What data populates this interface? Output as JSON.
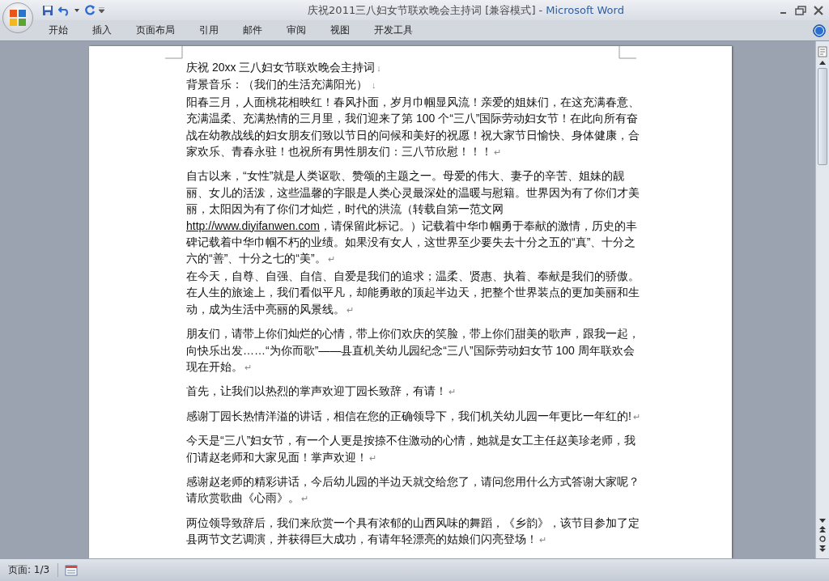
{
  "window": {
    "title": "庆祝2011三八妇女节联欢晚会主持词 [兼容模式]",
    "separator": "-",
    "app_name": "Microsoft Word"
  },
  "ribbon_tabs": [
    {
      "label": "开始",
      "selected": false
    },
    {
      "label": "插入",
      "selected": false
    },
    {
      "label": "页面布局",
      "selected": false
    },
    {
      "label": "引用",
      "selected": false
    },
    {
      "label": "邮件",
      "selected": false
    },
    {
      "label": "审阅",
      "selected": false
    },
    {
      "label": "视图",
      "selected": false
    },
    {
      "label": "开发工具",
      "selected": false
    }
  ],
  "document": {
    "blocks": [
      [
        {
          "text": "庆祝 20xx 三八妇女节联欢晚会主持词",
          "mark": "↓"
        },
        {
          "text": "背景音乐：（我们的生活充满阳光）",
          "mark": " ↓"
        },
        {
          "text": "阳春三月，人面桃花相映红！春风扑面，岁月巾帼显风流！亲爱的姐妹们，在这充满春意、充满温柔、充满热情的三月里，我们迎来了第 100 个“三八”国际劳动妇女节！在此向所有奋战在幼教战线的妇女朋友们致以节日的问候和美好的祝愿！祝大家节日愉快、身体健康，合家欢乐、青春永驻！也祝所有男性朋友们：三八节欣慰！！！",
          "mark": "↵"
        }
      ],
      [
        {
          "text": "自古以来，“女性”就是人类讴歌、赞颂的主题之一。母爱的伟大、妻子的辛苦、姐妹的靓丽、女儿的活泼，这些温馨的字眼是人类心灵最深处的温暖与慰籍。世界因为有了你们才美丽，太阳因为有了你们才灿烂，时代的洪流（转载自第一范文网 ",
          "link": "http://www.diyifanwen.com",
          "after": "，请保留此标记。）记载着中华巾帼勇于奉献的激情，历史的丰碑记载着中华巾帼不朽的业绩。如果没有女人，这世界至少要失去十分之五的“真”、十分之六的“善”、十分之七的“美”。",
          "mark": "↵"
        },
        {
          "text": "在今天，自尊、自强、自信、自爱是我们的追求；温柔、贤惠、执着、奉献是我们的骄傲。在人生的旅途上，我们看似平凡，却能勇敢的顶起半边天，把整个世界装点的更加美丽和生动，成为生活中亮丽的风景线。",
          "mark": "↵"
        }
      ],
      [
        {
          "text": "朋友们，请带上你们灿烂的心情，带上你们欢庆的笑脸，带上你们甜美的歌声，跟我一起，向快乐出发……“为你而歌”——县直机关幼儿园纪念“三八”国际劳动妇女节 100 周年联欢会现在开始。",
          "mark": "↵"
        }
      ],
      [
        {
          "text": "首先，让我们以热烈的掌声欢迎丁园长致辞，有请！",
          "mark": "↵"
        }
      ],
      [
        {
          "text": "感谢丁园长热情洋溢的讲话，相信在您的正确领导下，我们机关幼儿园一年更比一年红的!",
          "mark": "↵"
        }
      ],
      [
        {
          "text": "今天是“三八”妇女节，有一个人更是按捺不住激动的心情，她就是女工主任赵美珍老师，我们请赵老师和大家见面！掌声欢迎！",
          "mark": "↵"
        }
      ],
      [
        {
          "text": "感谢赵老师的精彩讲话，今后幼儿园的半边天就交给您了，请问您用什么方式答谢大家呢？请欣赏歌曲《心雨》。",
          "mark": "↵"
        }
      ],
      [
        {
          "text": "两位领导致辞后，我们来欣赏一个具有浓郁的山西风味的舞蹈，《乡韵》，该节目参加了定县两节文艺调演，并获得巨大成功，有请年轻漂亮的姑娘们闪亮登场！",
          "mark": "↵"
        }
      ]
    ]
  },
  "status_bar": {
    "page": "页面: 1/3"
  }
}
